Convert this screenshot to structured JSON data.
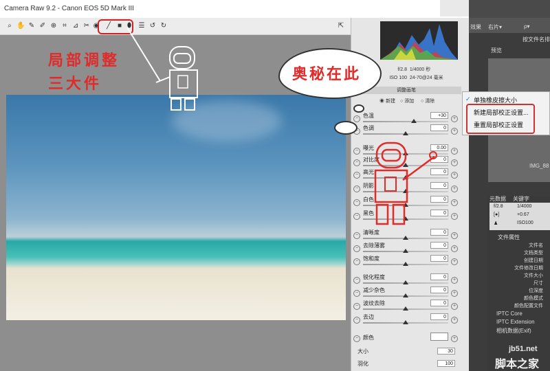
{
  "window": {
    "title": "Camera Raw 9.2 - Canon EOS 5D Mark III"
  },
  "toolbar": {
    "tools": [
      "zoom-icon",
      "hand-icon",
      "white-balance-icon",
      "color-sampler-icon",
      "target-adjust-icon",
      "crop-icon",
      "straighten-icon",
      "spot-removal-icon",
      "red-eye-icon",
      "adjustment-brush-icon",
      "graduated-filter-icon",
      "radial-filter-icon",
      "preferences-icon",
      "rotate-ccw-icon",
      "rotate-cw-icon"
    ]
  },
  "annotations": {
    "left_line1": "局部调整",
    "left_line2": "三大件",
    "bubble": "奥秘在此"
  },
  "exif": {
    "aperture": "f/2.8",
    "shutter": "1/4000 秒",
    "iso": "ISO 100",
    "lens": "24-70@24 毫米"
  },
  "panel": {
    "header": "调整画笔",
    "modes": [
      "新建",
      "添加",
      "清除"
    ],
    "selected_mode": "新建"
  },
  "sliders": [
    {
      "label": "色温",
      "value": "+30",
      "pos": 0.6
    },
    {
      "label": "色调",
      "value": "0",
      "pos": 0.5
    },
    {
      "label": "曝光",
      "value": "0.00",
      "pos": 0.5
    },
    {
      "label": "对比度",
      "value": "0",
      "pos": 0.5
    },
    {
      "label": "高光",
      "value": "0",
      "pos": 0.5
    },
    {
      "label": "阴影",
      "value": "0",
      "pos": 0.5
    },
    {
      "label": "白色",
      "value": "0",
      "pos": 0.5
    },
    {
      "label": "黑色",
      "value": "0",
      "pos": 0.5
    },
    {
      "label": "清晰度",
      "value": "0",
      "pos": 0.5
    },
    {
      "label": "去除薄雾",
      "value": "0",
      "pos": 0.5
    },
    {
      "label": "饱和度",
      "value": "0",
      "pos": 0.5
    },
    {
      "label": "锐化程度",
      "value": "0",
      "pos": 0.5
    },
    {
      "label": "减少杂色",
      "value": "0",
      "pos": 0.5
    },
    {
      "label": "波纹去除",
      "value": "0",
      "pos": 0.5
    },
    {
      "label": "去边",
      "value": "0",
      "pos": 0.5
    }
  ],
  "color_row": {
    "label": "颜色"
  },
  "brush": [
    {
      "label": "大小",
      "value": "30"
    },
    {
      "label": "羽化",
      "value": "100"
    }
  ],
  "menu": {
    "items": [
      {
        "label": "单独橡皮擦大小",
        "checked": true
      },
      {
        "label": "新建局部校正设置...",
        "checked": false
      },
      {
        "label": "重置局部校正设置",
        "checked": false
      }
    ]
  },
  "bridge": {
    "top_items": [
      "效果",
      "右片▾",
      "ρ▾"
    ],
    "subtitle": "按文件名排序",
    "tab": "预览",
    "thumb_label": "IMG_88",
    "tabs": [
      "元数据",
      "关键字"
    ],
    "meta": [
      {
        "a": "f/2.8",
        "b": "1/4000"
      },
      {
        "a": "[●]",
        "b": "+0.67"
      },
      {
        "a": "♟",
        "b": "ISO100"
      }
    ],
    "section_file": "文件属性",
    "props": [
      "文件名",
      "文档类型",
      "创建日期",
      "文件修改日期",
      "文件大小",
      "尺寸",
      "位深度",
      "颜色模式",
      "颜色配置文件"
    ],
    "section_iptc": "IPTC Core",
    "section_iptc_ext": "IPTC Extension",
    "section_camera": "相机数据(Exif)"
  },
  "watermark": {
    "url": "jb51.net",
    "name": "脚本之家"
  }
}
